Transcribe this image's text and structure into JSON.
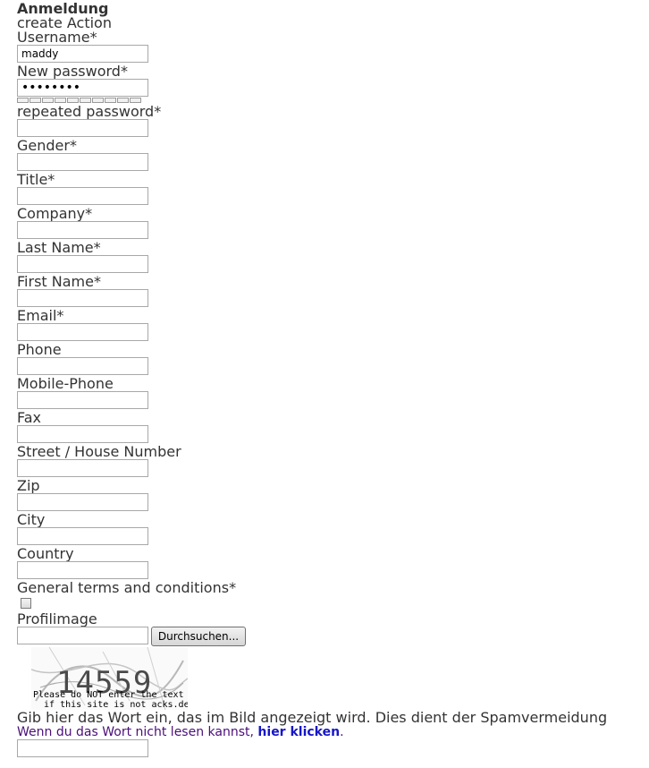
{
  "form": {
    "heading": "Anmeldung",
    "subheading": "create Action",
    "fields": [
      {
        "key": "username",
        "label": "Username*",
        "value": "maddy"
      },
      {
        "key": "new_password",
        "label": "New password*",
        "value": "••••••••"
      },
      {
        "key": "repeated_password",
        "label": "repeated password*",
        "value": ""
      },
      {
        "key": "gender",
        "label": "Gender*",
        "value": ""
      },
      {
        "key": "title",
        "label": "Title*",
        "value": ""
      },
      {
        "key": "company",
        "label": "Company*",
        "value": ""
      },
      {
        "key": "last_name",
        "label": "Last Name*",
        "value": ""
      },
      {
        "key": "first_name",
        "label": "First Name*",
        "value": ""
      },
      {
        "key": "email",
        "label": "Email*",
        "value": ""
      },
      {
        "key": "phone",
        "label": "Phone",
        "value": ""
      },
      {
        "key": "mobile_phone",
        "label": "Mobile-Phone",
        "value": ""
      },
      {
        "key": "fax",
        "label": "Fax",
        "value": ""
      },
      {
        "key": "street",
        "label": "Street / House Number",
        "value": ""
      },
      {
        "key": "zip",
        "label": "Zip",
        "value": ""
      },
      {
        "key": "city",
        "label": "City",
        "value": ""
      },
      {
        "key": "country",
        "label": "Country",
        "value": ""
      }
    ],
    "terms_label": "General terms and conditions*",
    "terms_checked": false,
    "profile_image_label": "Profilimage",
    "browse_button_label": "Durchsuchen..."
  },
  "captcha": {
    "image_number": "14559",
    "image_note": "Please do NOT enter the text\n  if this site is not acks.de",
    "instructions": "Gib hier das Wort ein, das im Bild angezeigt wird. Dies dient der Spamvermeidung",
    "help_text": "Wenn du das Wort nicht lesen kannst,",
    "help_link": "hier klicken",
    "help_suffix": ".",
    "input_value": ""
  }
}
